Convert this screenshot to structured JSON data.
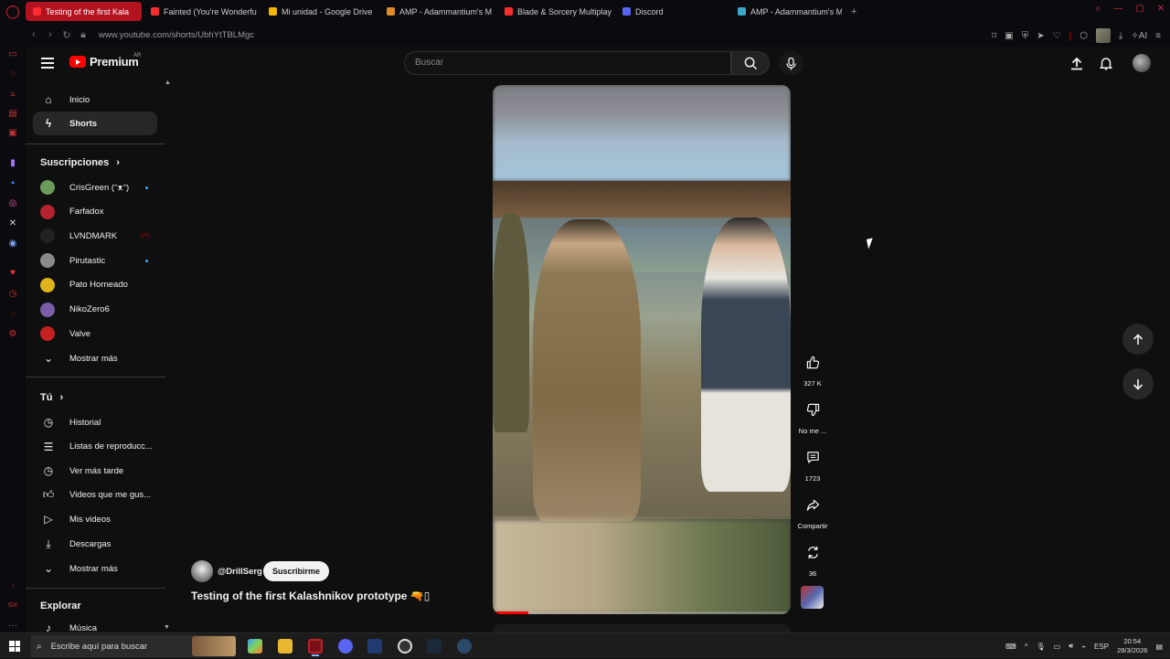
{
  "browser": {
    "tabs": [
      {
        "label": "Testing of the first Kala",
        "active": true,
        "color": "#ff2d2d"
      },
      {
        "label": "Fainted (You're Wonderfu",
        "active": false,
        "color": "#ff2d2d"
      },
      {
        "label": "Mi unidad - Google Drive",
        "active": false,
        "color": "#f2b600"
      },
      {
        "label": "AMP - Adammantium's M",
        "active": false,
        "color": "#e08a2a"
      },
      {
        "label": "Blade & Sorcery Multiplay",
        "active": false,
        "color": "#ff2d2d"
      },
      {
        "label": "Discord",
        "active": false,
        "color": "#5865f2"
      },
      {
        "label": "AMP - Adammantium's M",
        "active": false,
        "color": "#3ba8c9"
      }
    ],
    "url": "www.youtube.com/shorts/UbhYtTBLMgc"
  },
  "yt": {
    "logo_text": "Premium",
    "region": "AR",
    "search_placeholder": "Buscar",
    "nav": {
      "home": "Inicio",
      "shorts": "Shorts"
    },
    "subscriptions_title": "Suscripciones",
    "subscriptions": [
      {
        "name": "CrisGreen (ᵔᴥᵔ)",
        "color": "#6b9b5a",
        "indicator": "dot"
      },
      {
        "name": "Farfadox",
        "color": "#b3232f",
        "indicator": ""
      },
      {
        "name": "LVNDMARK",
        "color": "#222222",
        "indicator": "live"
      },
      {
        "name": "Pirutastic",
        "color": "#8a8a8a",
        "indicator": "dot"
      },
      {
        "name": "Pato Horneado",
        "color": "#e0b21c",
        "indicator": ""
      },
      {
        "name": "NikoZero6",
        "color": "#7a5ca8",
        "indicator": ""
      },
      {
        "name": "Valve",
        "color": "#c42020",
        "indicator": ""
      }
    ],
    "show_more": "Mostrar más",
    "you_title": "Tú",
    "you_items": [
      "Historial",
      "Listas de reproducc...",
      "Ver más tarde",
      "Videos que me gus...",
      "Mis videos",
      "Descargas"
    ],
    "show_more_2": "Mostrar más",
    "explore_title": "Explorar",
    "explore_items": [
      "Música"
    ]
  },
  "short": {
    "channel": "@DrillSerg",
    "subscribe_label": "Suscribirme",
    "title": "Testing of the first Kalashnikov prototype 🔫▯",
    "progress": 0.12,
    "likes": "327 K",
    "dislike_label": "No me ...",
    "comments": "1723",
    "share_label": "Compartir",
    "remix": "36"
  },
  "taskbar": {
    "search_placeholder": "Escribe aquí para buscar",
    "lang": "ESP",
    "time": "20:54",
    "date": "28/3/2026"
  }
}
